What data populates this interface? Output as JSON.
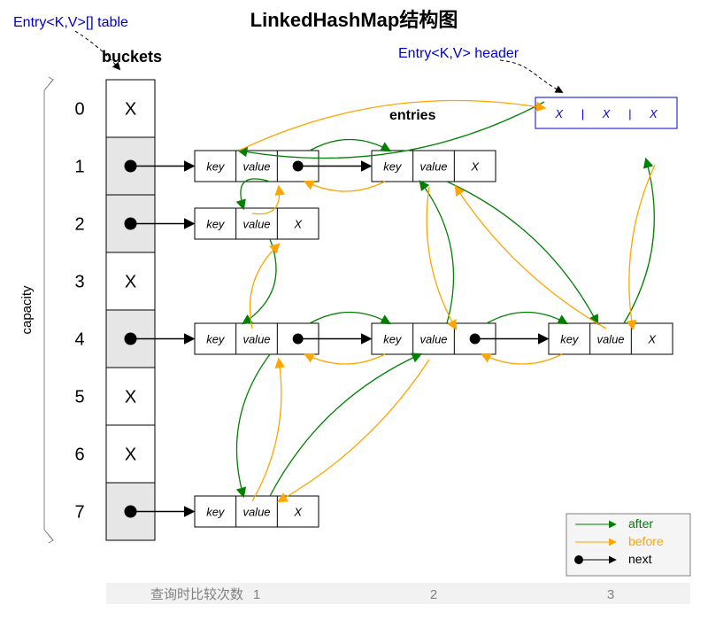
{
  "title": "LinkedHashMap结构图",
  "tableLabel": "Entry<K,V>[] table",
  "headerLabel": "Entry<K,V> header",
  "bucketsLbl": "buckets",
  "entriesLbl": "entries",
  "capacityLbl": "capacity",
  "buckets": [
    {
      "idx": "0",
      "content": "X",
      "filled": false
    },
    {
      "idx": "1",
      "content": "●",
      "filled": true
    },
    {
      "idx": "2",
      "content": "●",
      "filled": true
    },
    {
      "idx": "3",
      "content": "X",
      "filled": false
    },
    {
      "idx": "4",
      "content": "●",
      "filled": true
    },
    {
      "idx": "5",
      "content": "X",
      "filled": false
    },
    {
      "idx": "6",
      "content": "X",
      "filled": false
    },
    {
      "idx": "7",
      "content": "●",
      "filled": true
    }
  ],
  "entryCells": {
    "key": "key",
    "value": "value",
    "null": "X",
    "ptr": "●"
  },
  "header": {
    "a": "X",
    "b": "X",
    "c": "X"
  },
  "headerSep": "|",
  "legend": {
    "after": "after",
    "before": "before",
    "next": "next"
  },
  "footer": {
    "label": "查询时比较次数",
    "c1": "1",
    "c2": "2",
    "c3": "3"
  },
  "colors": {
    "after": "#008000",
    "before": "#ffa500",
    "next": "#000000",
    "bucketFill": "#e6e6e6",
    "legendBg": "#f5f5f5",
    "header": "#0000cd"
  },
  "layout": {
    "bucketX": 120,
    "bucketW": 55,
    "bucketTop": 90,
    "bucketH": 65,
    "entryW": 140,
    "entryH": 35,
    "col1": 220,
    "col2": 420,
    "col3": 620,
    "headerX": 605,
    "headerY": 110
  }
}
